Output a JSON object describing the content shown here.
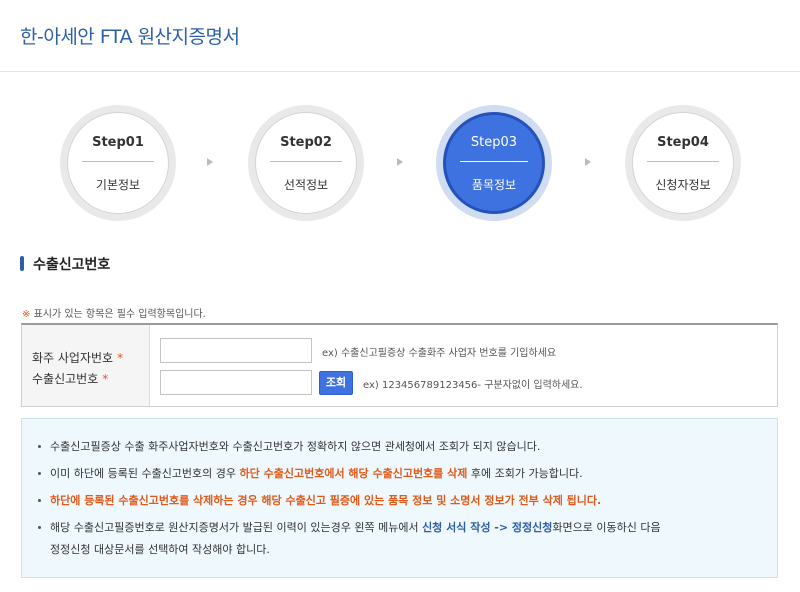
{
  "header": {
    "title": "한-아세안 FTA 원산지증명서"
  },
  "steps": [
    {
      "num": "Step01",
      "name": "기본정보",
      "active": false
    },
    {
      "num": "Step02",
      "name": "선적정보",
      "active": false
    },
    {
      "num": "Step03",
      "name": "품목정보",
      "active": true
    },
    {
      "num": "Step04",
      "name": "신청자정보",
      "active": false
    }
  ],
  "section": {
    "title": "수출신고번호"
  },
  "required_note": {
    "mark": "※",
    "text": " 표시가 있는 항목은 필수 입력항목입니다."
  },
  "form": {
    "label_business": "화주 사업자번호",
    "label_declaration": "수출신고번호",
    "star": "*",
    "business_value": "",
    "declaration_value": "",
    "business_hint": "ex) 수출신고필증상 수출화주 사업자 번호를 기입하세요",
    "search_button": "조회",
    "declaration_hint": "ex) 123456789123456- 구분자없이 입력하세요."
  },
  "notice": {
    "item1": "수출신고필증상 수출 화주사업자번호와 수출신고번호가 정확하지 않으면 관세청에서 조회가 되지 않습니다.",
    "item2_a": "이미 하단에 등록된 수출신고번호의 경우 ",
    "item2_b": "하단 수출신고번호에서 해당 수출신고번호를 삭제",
    "item2_c": " 후에 조회가 가능합니다.",
    "item3": "하단에 등록된 수출신고번호를 삭제하는 경우 해당 수출신고 필증에 있는 품목 정보 및 소명서 정보가 전부 삭제 됩니다.",
    "item4_a": "해당 수출신고필증번호로 원산지증명서가 발급된 이력이 있는경우 왼쪽 메뉴에서 ",
    "item4_b": "신청 서식 작성 -> 정정신청",
    "item4_c": "화면으로 이동하신 다음",
    "item4_d": "정정신청 대상문서를 선택하여 작성해야 합니다."
  },
  "colors": {
    "accent": "#3d72e0",
    "title": "#2d5fa8",
    "warning": "#e05a1a",
    "notice_bg": "#eef8fd"
  }
}
